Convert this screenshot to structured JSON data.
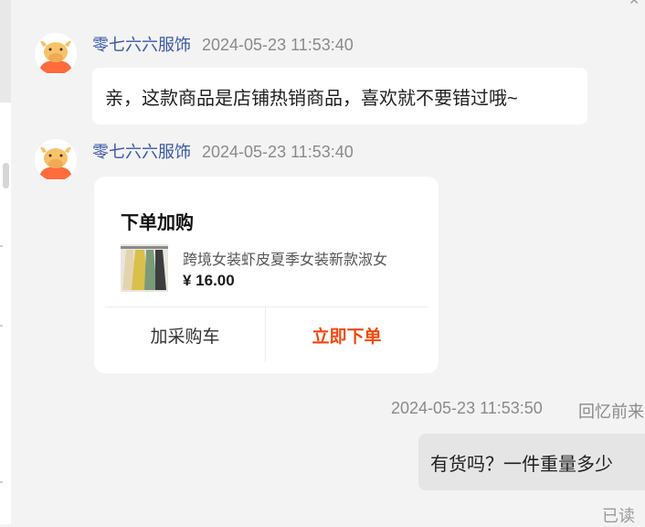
{
  "messages": [
    {
      "sender": "零七六六服饰",
      "time": "2024-05-23 11:53:40",
      "text": "亲，这款商品是店铺热销商品，喜欢就不要错过哦~"
    },
    {
      "sender": "零七六六服饰",
      "time": "2024-05-23 11:53:40",
      "card": {
        "title": "下单加购",
        "product_name": "跨境女装虾皮夏季女装新款淑女",
        "price": "¥ 16.00",
        "add_cart_label": "加采购车",
        "order_now_label": "立即下单"
      }
    }
  ],
  "outgoing": {
    "time": "2024-05-23 11:53:50",
    "recall_label": "回忆前来",
    "text": "有货吗？一件重量多少",
    "status": "已读"
  },
  "colors": {
    "sender": "#3b58a8",
    "accent": "#f2470f",
    "avatar_orange": "#ff6b3d",
    "avatar_cow": "#f6c36b",
    "chat_bg": "#f3f3f3"
  },
  "icons": {
    "avatar": "cow-mascot-icon",
    "top_corner": "close-icon"
  }
}
